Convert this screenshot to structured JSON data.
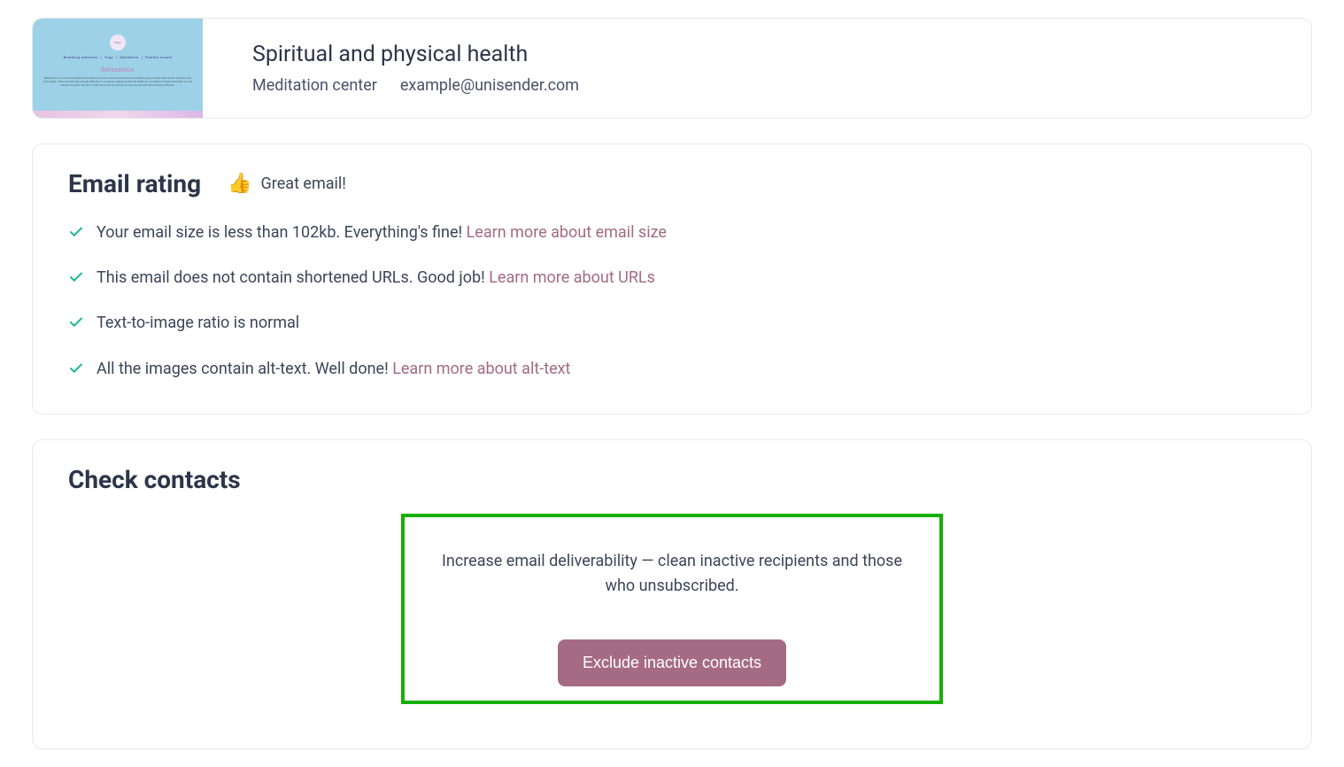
{
  "campaign": {
    "title": "Spiritual and physical health",
    "sender": "Meditation center",
    "email": "example@unisender.com",
    "thumb": {
      "top_strip": "",
      "logo_text": "logo",
      "nav_items": [
        "Breathing exercises",
        "Yoga",
        "Meditation",
        "Positive impact"
      ],
      "hero_title": "Relaxation",
      "hero_body": "Relaxation is an important ability that allows you to be more productive in accomplishing your daily tasks and to achieve long-term goals. Often we don't pay enough attention to ourselves, believing that the faster we complete our tasks the faster we will achieve all goals. Sooner or later the power is running out and we become tired and less effective."
    }
  },
  "rating": {
    "title": "Email rating",
    "badge_icon": "thumbs-up-icon",
    "badge_text": "Great email!",
    "items": [
      {
        "text": "Your email size is less than 102kb. Everything's fine! ",
        "learn": "Learn more about email size"
      },
      {
        "text": "This email does not contain shortened URLs. Good job! ",
        "learn": "Learn more about URLs"
      },
      {
        "text": "Text-to-image ratio is normal",
        "learn": ""
      },
      {
        "text": "All the images contain alt-text. Well done! ",
        "learn": "Learn more about alt-text"
      }
    ]
  },
  "contacts": {
    "title": "Check contacts",
    "deliverability_text": "Increase email deliverability — clean inactive recipients and those who unsubscribed.",
    "exclude_button": "Exclude inactive contacts"
  },
  "colors": {
    "link": "#a36b81",
    "button_bg": "#a66b84",
    "highlight_border": "#17b002",
    "check_stroke": "#1fb899"
  }
}
